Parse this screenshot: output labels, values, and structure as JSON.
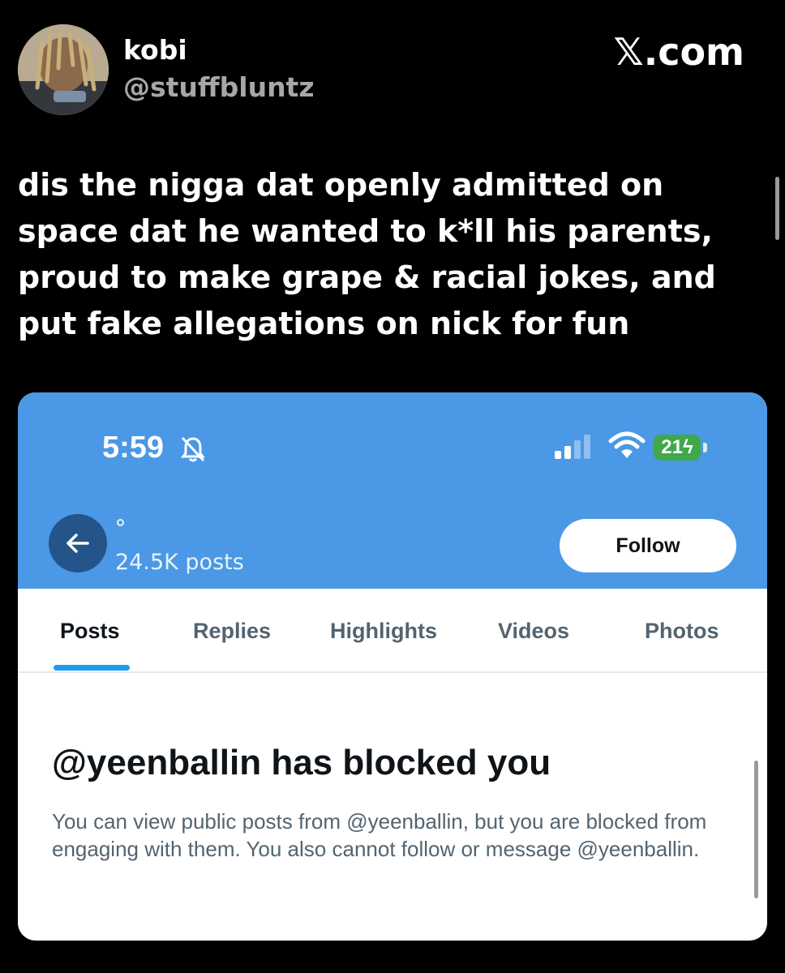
{
  "tweet": {
    "author_name": "kobi",
    "author_handle": "@stuffbluntz",
    "source_label": "𝕏.com",
    "text": "dis the nigga dat openly admitted on space dat he wanted to k*ll his parents, proud to make grape & racial jokes, and put fake allegations on nick for fun"
  },
  "screenshot": {
    "status_bar": {
      "time": "5:59",
      "battery": "21"
    },
    "profile": {
      "post_count": "24.5K posts",
      "follow_label": "Follow"
    },
    "tabs": [
      {
        "label": "Posts",
        "active": true
      },
      {
        "label": "Replies",
        "active": false
      },
      {
        "label": "Highlights",
        "active": false
      },
      {
        "label": "Videos",
        "active": false
      },
      {
        "label": "Photos",
        "active": false
      }
    ],
    "blocked": {
      "title": "@yeenballin has blocked you",
      "description": "You can view public posts from @yeenballin, but you are blocked from engaging with them. You also cannot follow or message @yeenballin."
    }
  },
  "colors": {
    "header_blue": "#4a98e6",
    "back_button": "#24548a",
    "tab_accent": "#1d9bf0",
    "battery_green": "#40a84a"
  }
}
